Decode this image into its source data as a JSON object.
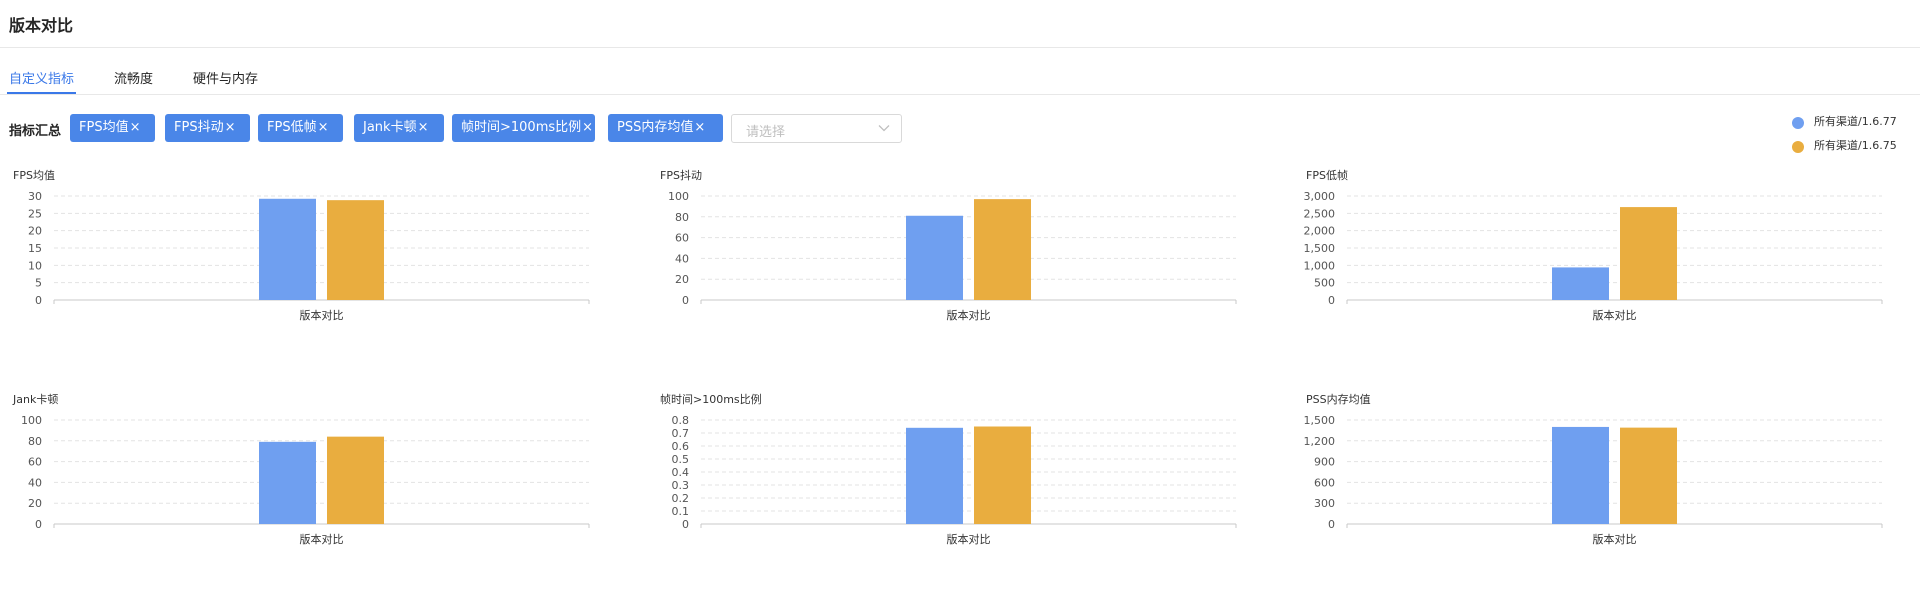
{
  "header": {
    "title": "版本对比"
  },
  "tabs": [
    {
      "label": "自定义指标",
      "active": true
    },
    {
      "label": "流畅度",
      "active": false
    },
    {
      "label": "硬件与内存",
      "active": false
    }
  ],
  "filters": {
    "label": "指标汇总",
    "tags": [
      {
        "label": "FPS均值",
        "close": "×"
      },
      {
        "label": "FPS抖动",
        "close": "×"
      },
      {
        "label": "FPS低帧",
        "close": "×"
      },
      {
        "label": "Jank卡顿",
        "close": "×"
      },
      {
        "label": "帧时间>100ms比例",
        "close": "×"
      },
      {
        "label": "PSS内存均值",
        "close": "×"
      }
    ],
    "select_placeholder": "请选择"
  },
  "legend": [
    {
      "label": "所有渠道/1.6.77",
      "color": "#6f9ff0"
    },
    {
      "label": "所有渠道/1.6.75",
      "color": "#e9ad3f"
    }
  ],
  "colors": {
    "accent": "#3a78e8",
    "series1": "#6f9ff0",
    "series2": "#e9ad3f",
    "tag_bg": "#4a86e8"
  },
  "chart_data": [
    {
      "type": "bar",
      "title": "FPS均值",
      "categories": [
        "版本对比"
      ],
      "series": [
        {
          "name": "所有渠道/1.6.77",
          "values": [
            29.2
          ]
        },
        {
          "name": "所有渠道/1.6.75",
          "values": [
            28.8
          ]
        }
      ],
      "ylim": [
        0,
        30
      ],
      "yticks": [
        0,
        5,
        10,
        15,
        20,
        25,
        30
      ],
      "ytick_labels": [
        "0",
        "5",
        "10",
        "15",
        "20",
        "25",
        "30"
      ],
      "grid": true
    },
    {
      "type": "bar",
      "title": "FPS抖动",
      "categories": [
        "版本对比"
      ],
      "series": [
        {
          "name": "所有渠道/1.6.77",
          "values": [
            81
          ]
        },
        {
          "name": "所有渠道/1.6.75",
          "values": [
            97
          ]
        }
      ],
      "ylim": [
        0,
        100
      ],
      "yticks": [
        0,
        20,
        40,
        60,
        80,
        100
      ],
      "ytick_labels": [
        "0",
        "20",
        "40",
        "60",
        "80",
        "100"
      ],
      "grid": true
    },
    {
      "type": "bar",
      "title": "FPS低帧",
      "categories": [
        "版本对比"
      ],
      "series": [
        {
          "name": "所有渠道/1.6.77",
          "values": [
            940
          ]
        },
        {
          "name": "所有渠道/1.6.75",
          "values": [
            2680
          ]
        }
      ],
      "ylim": [
        0,
        3000
      ],
      "yticks": [
        0,
        500,
        1000,
        1500,
        2000,
        2500,
        3000
      ],
      "ytick_labels": [
        "0",
        "500",
        "1,000",
        "1,500",
        "2,000",
        "2,500",
        "3,000"
      ],
      "grid": true
    },
    {
      "type": "bar",
      "title": "Jank卡顿",
      "categories": [
        "版本对比"
      ],
      "series": [
        {
          "name": "所有渠道/1.6.77",
          "values": [
            79
          ]
        },
        {
          "name": "所有渠道/1.6.75",
          "values": [
            84
          ]
        }
      ],
      "ylim": [
        0,
        100
      ],
      "yticks": [
        0,
        20,
        40,
        60,
        80,
        100
      ],
      "ytick_labels": [
        "0",
        "20",
        "40",
        "60",
        "80",
        "100"
      ],
      "grid": true
    },
    {
      "type": "bar",
      "title": "帧时间>100ms比例",
      "categories": [
        "版本对比"
      ],
      "series": [
        {
          "name": "所有渠道/1.6.77",
          "values": [
            0.74
          ]
        },
        {
          "name": "所有渠道/1.6.75",
          "values": [
            0.75
          ]
        }
      ],
      "ylim": [
        0,
        0.8
      ],
      "yticks": [
        0,
        0.1,
        0.2,
        0.3,
        0.4,
        0.5,
        0.6,
        0.7,
        0.8
      ],
      "ytick_labels": [
        "0",
        "0.1",
        "0.2",
        "0.3",
        "0.4",
        "0.5",
        "0.6",
        "0.7",
        "0.8"
      ],
      "grid": true
    },
    {
      "type": "bar",
      "title": "PSS内存均值",
      "categories": [
        "版本对比"
      ],
      "series": [
        {
          "name": "所有渠道/1.6.77",
          "values": [
            1400
          ]
        },
        {
          "name": "所有渠道/1.6.75",
          "values": [
            1390
          ]
        }
      ],
      "ylim": [
        0,
        1500
      ],
      "yticks": [
        0,
        300,
        600,
        900,
        1200,
        1500
      ],
      "ytick_labels": [
        "0",
        "300",
        "600",
        "900",
        "1,200",
        "1,500"
      ],
      "grid": true
    }
  ]
}
